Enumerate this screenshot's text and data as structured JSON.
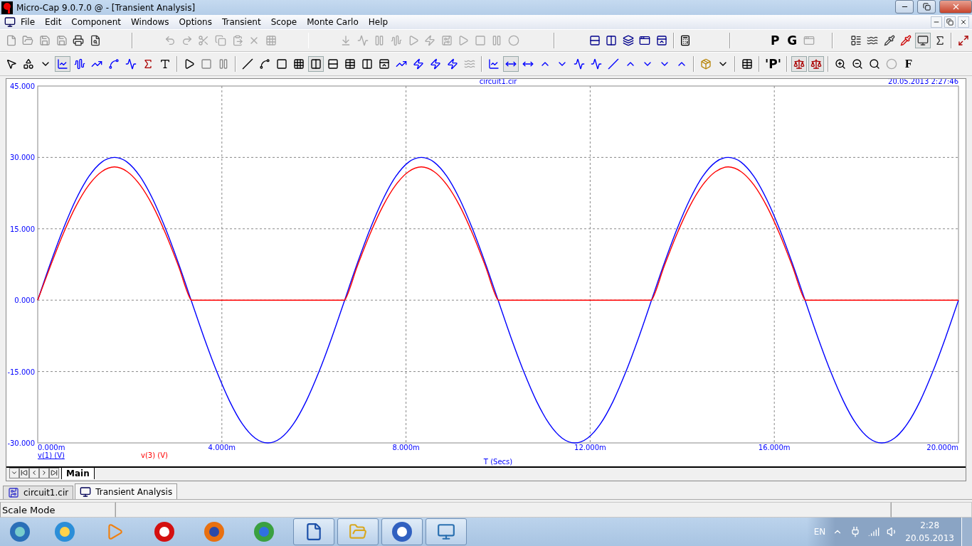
{
  "window": {
    "title": "Micro-Cap 9.0.7.0 @ - [Transient Analysis]"
  },
  "menu": [
    "File",
    "Edit",
    "Component",
    "Windows",
    "Options",
    "Transient",
    "Scope",
    "Monte Carlo",
    "Help"
  ],
  "toolbar_1": {
    "text_buttons": [
      "P",
      "G"
    ]
  },
  "toolbar_2": {
    "text_buttons": [
      "'P'",
      "F"
    ]
  },
  "plot": {
    "file_title": "circuit1.cir",
    "timestamp": "20.05.2013 2:27:46",
    "legend": [
      {
        "underlined": true
      },
      {
        "underlined": false
      }
    ],
    "chart_data": {
      "type": "line",
      "xlabel": "T (Secs)",
      "grid": true,
      "x": [
        0,
        0.278,
        0.556,
        0.833,
        1.111,
        1.389,
        1.667,
        1.944,
        2.222,
        2.5,
        2.778,
        3.056,
        3.333,
        3.611,
        3.889,
        4.167,
        4.444,
        4.722,
        5,
        5.278,
        5.556,
        5.833,
        6.111,
        6.389,
        6.667,
        6.944,
        7.222,
        7.5,
        7.778,
        8.056,
        8.333,
        8.611,
        8.889,
        9.167,
        9.444,
        9.722,
        10,
        10.278,
        10.556,
        10.833,
        11.111,
        11.389,
        11.667,
        11.944,
        12.222,
        12.5,
        12.778,
        13.056,
        13.333,
        13.611,
        13.889,
        14.167,
        14.444,
        14.722,
        15,
        15.278,
        15.556,
        15.833,
        16.111,
        16.389,
        16.667,
        16.944,
        17.222,
        17.5,
        17.778,
        18.056,
        18.333,
        18.611,
        18.889,
        19.167,
        19.444,
        19.722,
        20
      ],
      "series": [
        {
          "name": "v(1) (V)",
          "color": "#0000ff",
          "values": [
            0,
            7.8,
            15,
            21.2,
            26,
            29,
            30,
            29,
            26,
            21.2,
            15,
            7.8,
            0,
            -7.8,
            -15,
            -21.2,
            -26,
            -29,
            -30,
            -29,
            -26,
            -21.2,
            -15,
            -7.8,
            0,
            7.8,
            15,
            21.2,
            26,
            29,
            30,
            29,
            26,
            21.2,
            15,
            7.8,
            0,
            -7.8,
            -15,
            -21.2,
            -26,
            -29,
            -30,
            -29,
            -26,
            -21.2,
            -15,
            -7.8,
            0,
            7.8,
            15,
            21.2,
            26,
            29,
            30,
            29,
            26,
            21.2,
            15,
            7.8,
            0,
            -7.8,
            -15,
            -21.2,
            -26,
            -29,
            -30,
            -29,
            -26,
            -21.2,
            -15,
            -7.8,
            0
          ]
        },
        {
          "name": "v(3) (V)",
          "color": "#ff0000",
          "values": [
            0,
            7.2,
            14,
            19.8,
            24.2,
            27,
            28,
            27,
            24.2,
            19.8,
            14,
            7.2,
            0,
            0,
            0,
            0,
            0,
            0,
            0,
            0,
            0,
            0,
            0,
            0,
            0,
            7.2,
            14,
            19.8,
            24.2,
            27,
            28,
            27,
            24.2,
            19.8,
            14,
            7.2,
            0,
            0,
            0,
            0,
            0,
            0,
            0,
            0,
            0,
            0,
            0,
            0,
            0,
            7.2,
            14,
            19.8,
            24.2,
            27,
            28,
            27,
            24.2,
            19.8,
            14,
            7.2,
            0,
            0,
            0,
            0,
            0,
            0,
            0,
            0,
            0,
            0,
            0,
            0,
            0
          ]
        }
      ],
      "xlim": [
        0,
        20
      ],
      "ylim": [
        -30,
        45
      ],
      "xticks": [
        {
          "value": 0,
          "label": "0.000m"
        },
        {
          "value": 4,
          "label": "4.000m"
        },
        {
          "value": 8,
          "label": "8.000m"
        },
        {
          "value": 12,
          "label": "12.000m"
        },
        {
          "value": 16,
          "label": "16.000m"
        },
        {
          "value": 20,
          "label": "20.000m"
        }
      ],
      "yticks": [
        {
          "value": -30,
          "label": "-30.000"
        },
        {
          "value": -15,
          "label": "-15.000"
        },
        {
          "value": 0,
          "label": "0.000"
        },
        {
          "value": 15,
          "label": "15.000"
        },
        {
          "value": 30,
          "label": "30.000"
        },
        {
          "value": 45,
          "label": "45.000"
        }
      ]
    }
  },
  "page_tabs": [
    {
      "label": "Main",
      "selected": true
    }
  ],
  "document_tabs": [
    {
      "label": "circuit1.cir",
      "selected": false
    },
    {
      "label": "Transient Analysis",
      "selected": true
    }
  ],
  "status_bar": {
    "mode": "Scale Mode"
  },
  "taskbar": {
    "language": "EN",
    "time": "2:28",
    "date": "20.05.2013"
  }
}
